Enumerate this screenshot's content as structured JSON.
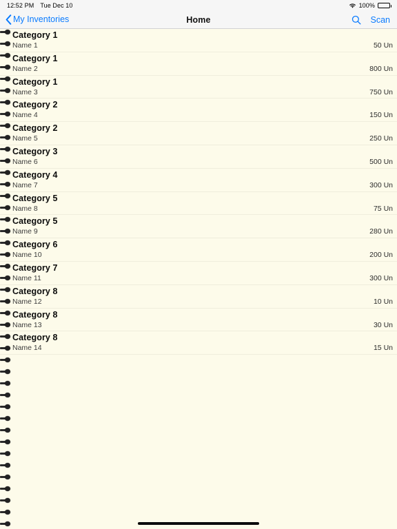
{
  "status_bar": {
    "time": "12:52 PM",
    "date": "Tue Dec 10",
    "wifi_icon": "wifi-icon",
    "battery_percent": "100%",
    "battery_icon": "battery-full-icon"
  },
  "nav_bar": {
    "back_icon": "chevron-left-icon",
    "back_label": "My Inventories",
    "title": "Home",
    "search_icon": "search-icon",
    "scan_label": "Scan",
    "accent_color": "#0A7BFF"
  },
  "page": {
    "background_color": "#FDFBEA",
    "binder_rings_icon": "spiral-binding-ring-icon",
    "ring_count": 43,
    "ring_spacing_px": 17
  },
  "list": {
    "rows": [
      {
        "category": "Category 1",
        "name": "Name 1",
        "quantity": "50 Un"
      },
      {
        "category": "Category 1",
        "name": "Name 2",
        "quantity": "800 Un"
      },
      {
        "category": "Category 1",
        "name": "Name 3",
        "quantity": "750 Un"
      },
      {
        "category": "Category 2",
        "name": "Name 4",
        "quantity": "150 Un"
      },
      {
        "category": "Category 2",
        "name": "Name 5",
        "quantity": "250 Un"
      },
      {
        "category": "Category 3",
        "name": "Name 6",
        "quantity": "500 Un"
      },
      {
        "category": "Category 4",
        "name": "Name 7",
        "quantity": "300 Un"
      },
      {
        "category": "Category 5",
        "name": "Name 8",
        "quantity": "75 Un"
      },
      {
        "category": "Category 5",
        "name": "Name 9",
        "quantity": "280 Un"
      },
      {
        "category": "Category 6",
        "name": "Name 10",
        "quantity": "200 Un"
      },
      {
        "category": "Category 7",
        "name": "Name 11",
        "quantity": "300 Un"
      },
      {
        "category": "Category 8",
        "name": "Name 12",
        "quantity": "10 Un"
      },
      {
        "category": "Category 8",
        "name": "Name 13",
        "quantity": "30 Un"
      },
      {
        "category": "Category 8",
        "name": "Name 14",
        "quantity": "15 Un"
      }
    ]
  },
  "home_indicator": {
    "icon": "home-indicator-bar"
  }
}
